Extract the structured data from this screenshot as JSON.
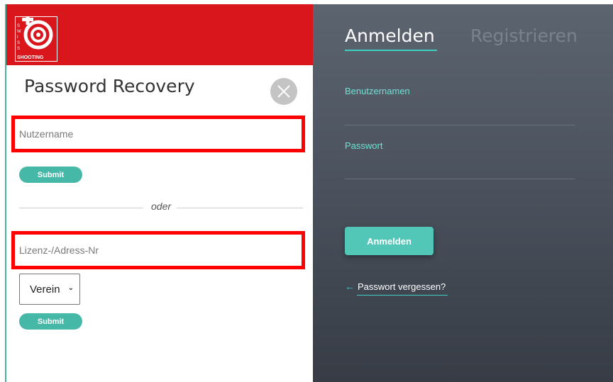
{
  "colors": {
    "brand_red": "#d8161b",
    "accent_teal": "#3ecfbf",
    "button_teal": "#52c7b8",
    "highlight_red": "#ff0000"
  },
  "logo": {
    "letters": "SWISS",
    "wordmark": "SHOOTING"
  },
  "recovery": {
    "title": "Password Recovery",
    "close_icon": "close-icon",
    "username_placeholder": "Nutzername",
    "submit_label": "Submit",
    "separator": "oder",
    "license_placeholder": "Lizenz-/Adress-Nr",
    "select_value": "Verein",
    "submit2_label": "Submit"
  },
  "login": {
    "tab_login": "Anmelden",
    "tab_register": "Registrieren",
    "username_label": "Benutzernamen",
    "password_label": "Passwort",
    "login_button": "Anmelden",
    "forgot_link": "Passwort vergessen?",
    "forgot_icon": "arrow-left-icon"
  }
}
